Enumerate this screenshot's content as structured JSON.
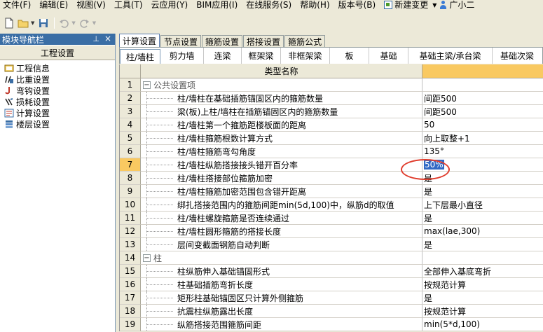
{
  "menu": [
    "文件(F)",
    "编辑(E)",
    "视图(V)",
    "工具(T)",
    "云应用(Y)",
    "BIM应用(I)",
    "在线服务(S)",
    "帮助(H)",
    "版本号(B)",
    "新建变更",
    "广小二"
  ],
  "left_panel": {
    "title": "模块导航栏",
    "header": "工程设置",
    "items": [
      "工程信息",
      "比重设置",
      "弯钩设置",
      "损耗设置",
      "计算设置",
      "楼层设置"
    ]
  },
  "tabs_top": [
    "计算设置",
    "节点设置",
    "箍筋设置",
    "搭接设置",
    "箍筋公式"
  ],
  "tabs_sub": [
    "柱/墙柱",
    "剪力墙",
    "连梁",
    "框架梁",
    "非框架梁",
    "板",
    "基础",
    "基础主梁/承台梁",
    "基础次梁"
  ],
  "grid": {
    "col_name": "类型名称",
    "rows": [
      {
        "num": "1",
        "name": "公共设置项",
        "value": "",
        "group": true
      },
      {
        "num": "2",
        "name": "柱/墙柱在基础插筋锚固区内的箍筋数量",
        "value": "间距500"
      },
      {
        "num": "3",
        "name": "梁(板)上柱/墙柱在插筋锚固区内的箍筋数量",
        "value": "间距500"
      },
      {
        "num": "4",
        "name": "柱/墙柱第一个箍筋距楼板面的距离",
        "value": "50"
      },
      {
        "num": "5",
        "name": "柱/墙柱箍筋根数计算方式",
        "value": "向上取整+1"
      },
      {
        "num": "6",
        "name": "柱/墙柱箍筋弯勾角度",
        "value": "135°"
      },
      {
        "num": "7",
        "name": "柱/墙柱纵筋搭接接头错开百分率",
        "value": "50%",
        "selected": true
      },
      {
        "num": "8",
        "name": "柱/墙柱搭接部位箍筋加密",
        "value": "是"
      },
      {
        "num": "9",
        "name": "柱/墙柱箍筋加密范围包含错开距离",
        "value": "是"
      },
      {
        "num": "10",
        "name": "绑扎搭接范围内的箍筋间距min(5d,100)中，纵筋d的取值",
        "value": "上下层最小直径"
      },
      {
        "num": "11",
        "name": "柱/墙柱螺旋箍筋是否连续通过",
        "value": "是"
      },
      {
        "num": "12",
        "name": "柱/墙柱圆形箍筋的搭接长度",
        "value": "max(lae,300)"
      },
      {
        "num": "13",
        "name": "层间变截面钢筋自动判断",
        "value": "是"
      },
      {
        "num": "14",
        "name": "柱",
        "value": "",
        "group": true
      },
      {
        "num": "15",
        "name": "柱纵筋伸入基础锚固形式",
        "value": "全部伸入基底弯折"
      },
      {
        "num": "16",
        "name": "柱基础插筋弯折长度",
        "value": "按规范计算"
      },
      {
        "num": "17",
        "name": "矩形柱基础锚固区只计算外侧箍筋",
        "value": "是"
      },
      {
        "num": "18",
        "name": "抗震柱纵筋露出长度",
        "value": "按规范计算"
      },
      {
        "num": "19",
        "name": "纵筋搭接范围箍筋间距",
        "value": "min(5*d,100)"
      }
    ]
  },
  "colors": {
    "accent": "#3a6ea5",
    "selection": "#316ac5",
    "highlight": "#f9c961",
    "annotation": "#e03c2c"
  }
}
